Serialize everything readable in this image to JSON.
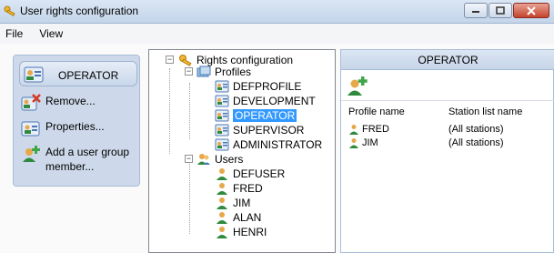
{
  "window": {
    "title": "User rights configuration"
  },
  "menu": [
    "File",
    "View"
  ],
  "task_pane": {
    "header": "OPERATOR",
    "items": [
      {
        "label": "Remove...",
        "icon": "remove-profile-icon"
      },
      {
        "label": "Properties...",
        "icon": "properties-icon"
      },
      {
        "label": "Add a user group member...",
        "icon": "add-user-icon"
      }
    ]
  },
  "tree": {
    "root": "Rights configuration",
    "profiles_label": "Profiles",
    "profiles": [
      "DEFPROFILE",
      "DEVELOPMENT",
      "OPERATOR",
      "SUPERVISOR",
      "ADMINISTRATOR"
    ],
    "selected_profile": "OPERATOR",
    "users_label": "Users",
    "users": [
      "DEFUSER",
      "FRED",
      "JIM",
      "ALAN",
      "HENRI"
    ]
  },
  "detail": {
    "title": "OPERATOR",
    "columns": [
      "Profile name",
      "Station list name"
    ],
    "rows": [
      {
        "name": "FRED",
        "stations": "(All stations)"
      },
      {
        "name": "JIM",
        "stations": "(All stations)"
      }
    ]
  }
}
